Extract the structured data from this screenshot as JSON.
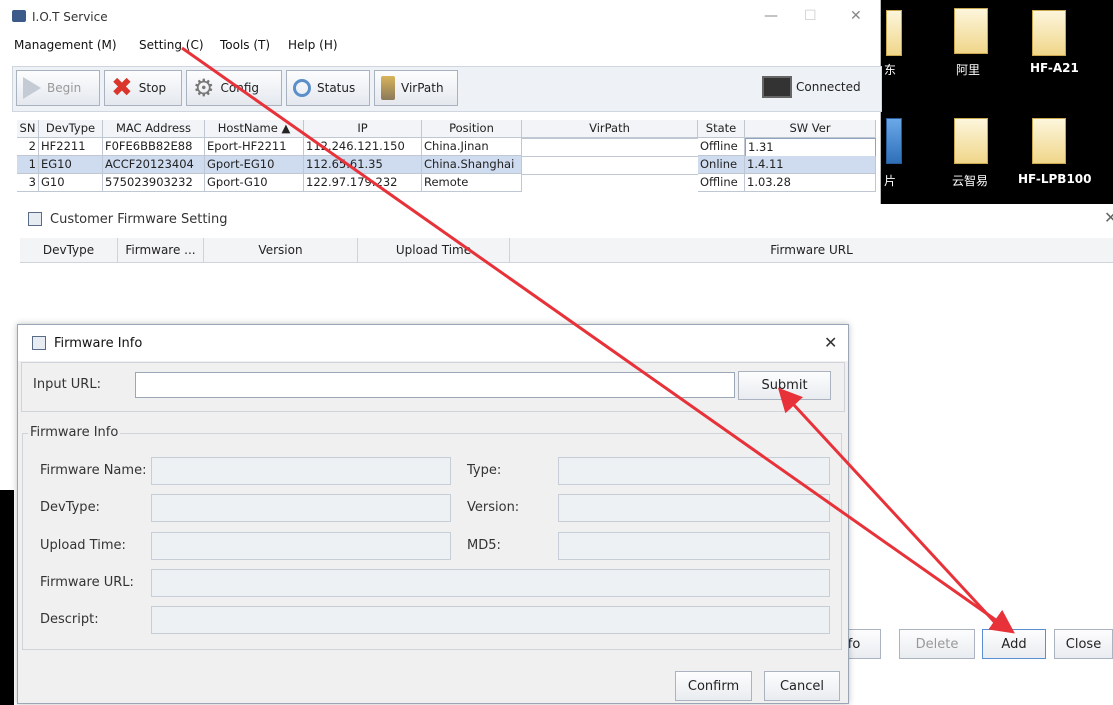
{
  "app": {
    "title": "I.O.T Service",
    "window_controls": [
      "—",
      "☐",
      "✕"
    ]
  },
  "menu": [
    "Management (M)",
    "Setting (C)",
    "Tools (T)",
    "Help (H)"
  ],
  "toolbar": {
    "begin": "Begin",
    "stop": "Stop",
    "config": "Config",
    "status": "Status",
    "virpath": "VirPath",
    "connected": "Connected"
  },
  "device_table": {
    "columns": [
      "SN",
      "DevType",
      "MAC Address",
      "HostName ▲",
      "IP",
      "Position",
      "VirPath",
      "State",
      "SW Ver"
    ],
    "rows": [
      {
        "sn": "2",
        "devtype": "HF2211",
        "mac": "F0FE6BB82E88",
        "hostname": "Eport-HF2211",
        "ip": "112.246.121.150",
        "position": "China.Jinan",
        "virpath": "",
        "state": "Offline",
        "swver": "1.31"
      },
      {
        "sn": "1",
        "devtype": "EG10",
        "mac": "ACCF20123404",
        "hostname": "Gport-EG10",
        "ip": "112.65.61.35",
        "position": "China.Shanghai",
        "virpath": "",
        "state": "Online",
        "swver": "1.4.11"
      },
      {
        "sn": "3",
        "devtype": "G10",
        "mac": "575023903232",
        "hostname": "Gport-G10",
        "ip": "122.97.179.232",
        "position": "Remote",
        "virpath": "",
        "state": "Offline",
        "swver": "1.03.28"
      }
    ]
  },
  "customer_dialog": {
    "title": "Customer Firmware Setting",
    "columns": [
      "DevType",
      "Firmware ...",
      "Version",
      "Upload Time",
      "Firmware URL"
    ],
    "buttons": {
      "info": "Info",
      "delete": "Delete",
      "add": "Add",
      "close": "Close"
    }
  },
  "firmware_dialog": {
    "title": "Firmware Info",
    "input_url_label": "Input URL:",
    "input_url_value": "",
    "submit": "Submit",
    "group_label": "Firmware Info",
    "labels": {
      "name": "Firmware Name:",
      "type": "Type:",
      "devtype": "DevType:",
      "version": "Version:",
      "upload_time": "Upload Time:",
      "md5": "MD5:",
      "url": "Firmware URL:",
      "descript": "Descript:"
    },
    "confirm": "Confirm",
    "cancel": "Cancel"
  },
  "desktop": {
    "labels_row1": [
      "东",
      "阿里",
      "HF-A21"
    ],
    "labels_row2": [
      "片",
      "云智易",
      "HF-LPB100"
    ]
  },
  "colors": {
    "annotation_arrow": "#e8323a",
    "selection": "#cfdcf0"
  }
}
